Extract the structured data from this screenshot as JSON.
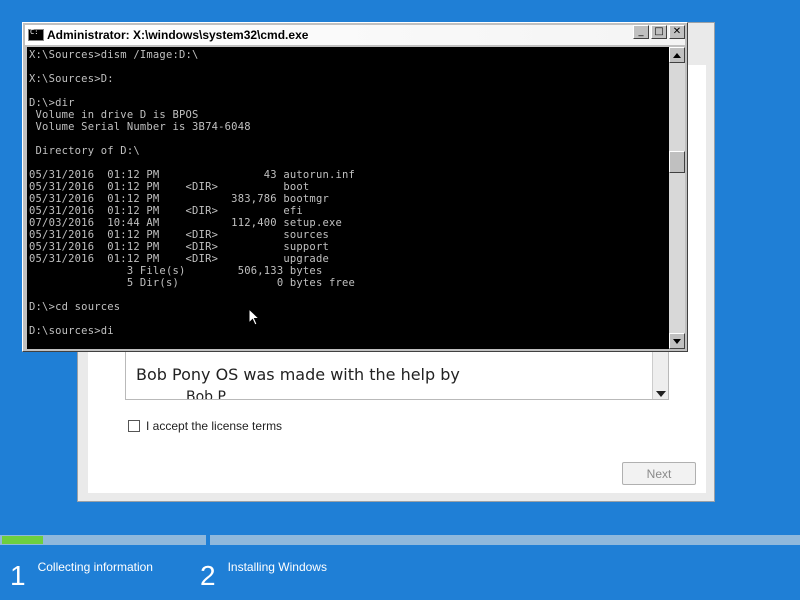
{
  "setup": {
    "license_text_line1": "Bob Pony OS was made with the help by",
    "license_text_line2": "Bob P",
    "accept_label": "I accept the license terms",
    "next_label": "Next"
  },
  "cmd": {
    "title": "Administrator: X:\\windows\\system32\\cmd.exe",
    "controls": {
      "minimize": "_",
      "maximize": "□",
      "close": "✕"
    },
    "lines": [
      "X:\\Sources>dism /Image:D:\\",
      "",
      "X:\\Sources>D:",
      "",
      "D:\\>dir",
      " Volume in drive D is BPOS",
      " Volume Serial Number is 3B74-6048",
      "",
      " Directory of D:\\",
      "",
      "05/31/2016  01:12 PM                43 autorun.inf",
      "05/31/2016  01:12 PM    <DIR>          boot",
      "05/31/2016  01:12 PM           383,786 bootmgr",
      "05/31/2016  01:12 PM    <DIR>          efi",
      "07/03/2016  10:44 AM           112,400 setup.exe",
      "05/31/2016  01:12 PM    <DIR>          sources",
      "05/31/2016  01:12 PM    <DIR>          support",
      "05/31/2016  01:12 PM    <DIR>          upgrade",
      "               3 File(s)        506,133 bytes",
      "               5 Dir(s)               0 bytes free",
      "",
      "D:\\>cd sources",
      "",
      "D:\\sources>di"
    ]
  },
  "progress": {
    "step1_fraction": 0.2,
    "steps": [
      {
        "number": "1",
        "label": "Collecting information"
      },
      {
        "number": "2",
        "label": "Installing Windows"
      }
    ]
  },
  "colors": {
    "desktop": "#1f7fd6",
    "progress_fill": "#6dcf3f",
    "console_text": "#c0c0c0"
  }
}
